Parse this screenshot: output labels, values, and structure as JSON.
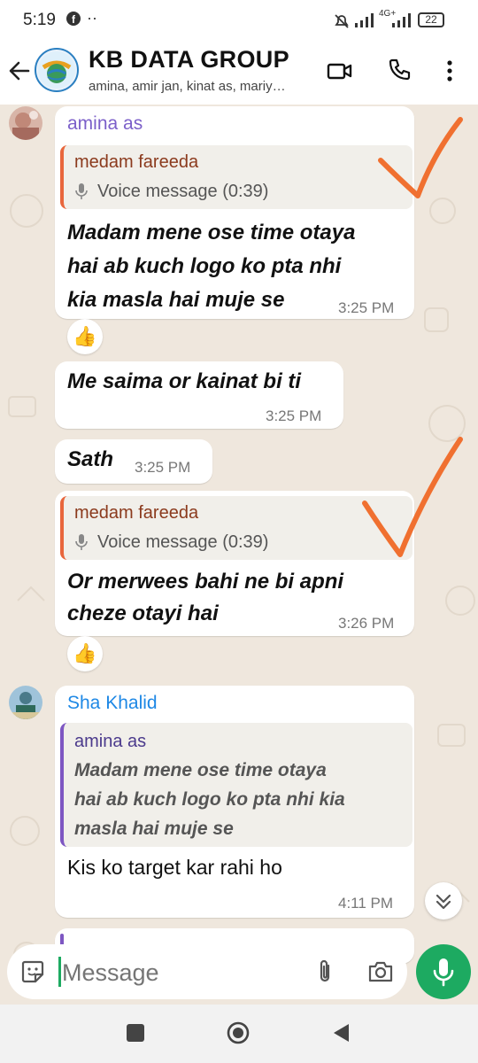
{
  "status_bar": {
    "time": "5:19",
    "network": "4G+",
    "battery": "22"
  },
  "header": {
    "title": "KB DATA GROUP",
    "subtitle": "amina, amir jan, kinat as, mariy…",
    "avatar_text": "OPEN DATA WATCH"
  },
  "messages": [
    {
      "sender": "amina as",
      "quote_name": "medam fareeda",
      "quote_text": "Voice message (0:39)",
      "lines": [
        "Madam mene ose time otaya",
        "hai ab kuch logo ko pta nhi",
        "kia masla hai muje se"
      ],
      "time": "3:25 PM",
      "reaction": "👍"
    },
    {
      "text": "Me saima or kainat bi ti",
      "time": "3:25 PM"
    },
    {
      "text": "Sath",
      "time": "3:25 PM"
    },
    {
      "quote_name": "medam fareeda",
      "quote_text": "Voice message (0:39)",
      "lines": [
        "Or merwees bahi ne bi apni",
        "cheze otayi hai"
      ],
      "time": "3:26 PM",
      "reaction": "👍"
    },
    {
      "sender": "Sha Khalid",
      "quote_name": "amina as",
      "quote_lines": [
        "Madam mene ose time otaya",
        "hai ab kuch logo ko pta nhi kia",
        "masla hai muje se"
      ],
      "text": "Kis ko target kar rahi ho",
      "time": "4:11 PM"
    }
  ],
  "composer": {
    "placeholder": "Message"
  },
  "colors": {
    "accent": "#1daa61",
    "wallpaper": "#efe7dd",
    "quote_bar": "#e8663c",
    "quote_bar_alt": "#7e57c2",
    "annotation": "#f07030",
    "sender1": "#7b5fc9",
    "sender2": "#1e88e5"
  }
}
